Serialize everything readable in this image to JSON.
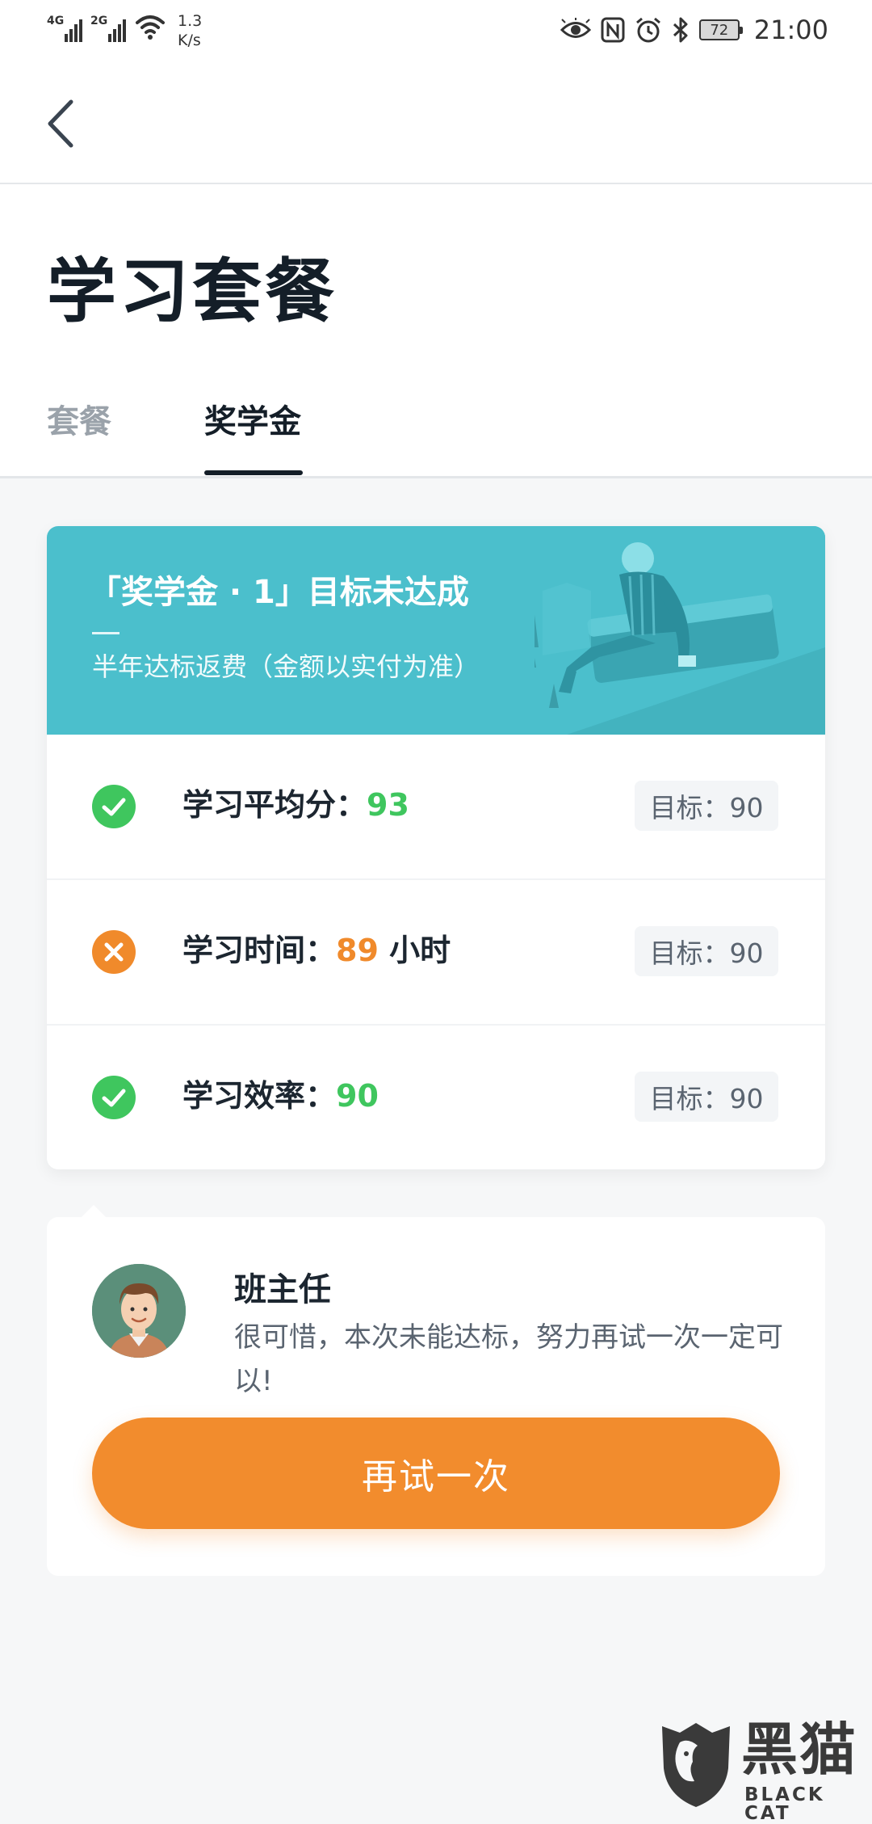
{
  "status_bar": {
    "signal_1_label": "4G",
    "signal_2_label": "2G",
    "net_speed_value": "1.3",
    "net_speed_unit": "K/s",
    "battery_level": "72",
    "time": "21:00"
  },
  "header": {
    "back_icon": "chevron-left-icon"
  },
  "page": {
    "title": "学习套餐"
  },
  "tabs": [
    {
      "label": "套餐",
      "active": false
    },
    {
      "label": "奖学金",
      "active": true
    }
  ],
  "scholarship": {
    "banner_title": "「奖学金 · 1」目标未达成",
    "banner_subtitle": "半年达标返费（金额以实付为准）",
    "banner_color": "#4bbfcc",
    "metrics": [
      {
        "label": "学习平均分：",
        "value": "93",
        "unit": "",
        "status": "passed",
        "target": "目标：90"
      },
      {
        "label": "学习时间：",
        "value": "89",
        "unit": " 小时",
        "status": "failed",
        "target": "目标：90"
      },
      {
        "label": "学习效率：",
        "value": "90",
        "unit": "",
        "status": "passed",
        "target": "目标：90"
      }
    ]
  },
  "teacher": {
    "name": "班主任",
    "message": "很可惜，本次未能达标，努力再试一次一定可以!"
  },
  "retry_button": {
    "label": "再试一次",
    "color": "#f28c2d"
  },
  "watermark": {
    "text": "黑猫",
    "sub": "BLACK CAT"
  }
}
